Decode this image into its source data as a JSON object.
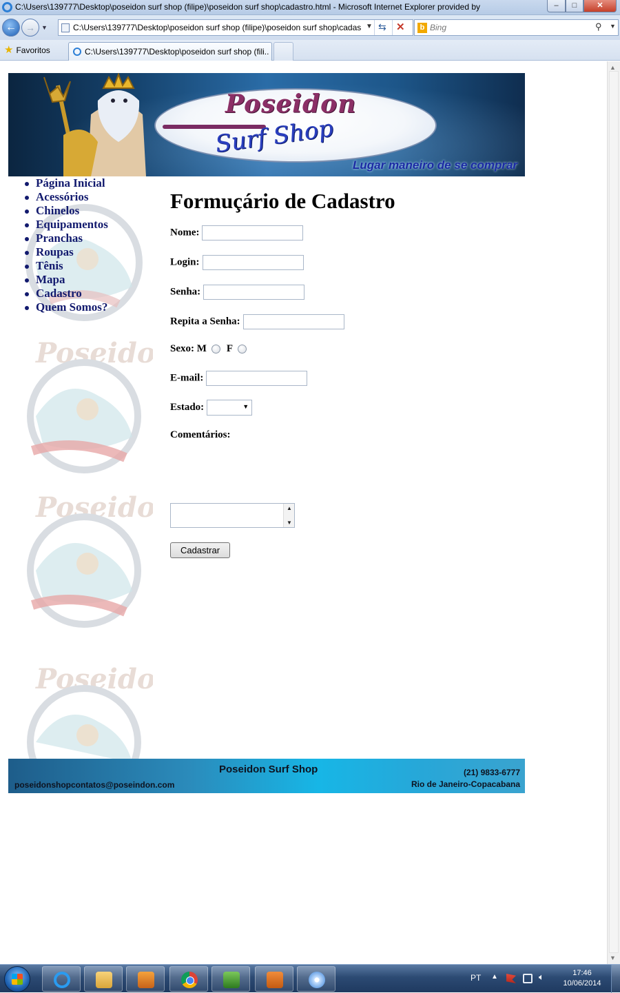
{
  "window": {
    "title": "C:\\Users\\139777\\Desktop\\poseidon surf shop (filipe)\\poseidon surf shop\\cadastro.html - Microsoft Internet Explorer provided by",
    "min_label": "–",
    "max_label": "□",
    "close_label": "✕"
  },
  "address_bar": {
    "url": "C:\\Users\\139777\\Desktop\\poseidon surf shop (filipe)\\poseidon surf shop\\cadas",
    "search_placeholder": "Bing"
  },
  "favorites": {
    "label": "Favoritos"
  },
  "tab": {
    "title": "C:\\Users\\139777\\Desktop\\poseidon surf shop (fili..."
  },
  "banner": {
    "brand_top": "Poseidon",
    "brand_bottom": "Surf Shop",
    "tagline": "Lugar maneiro de se comprar"
  },
  "sidebar": {
    "items": [
      {
        "label": "Página Inicial"
      },
      {
        "label": "Acessórios"
      },
      {
        "label": "Chinelos"
      },
      {
        "label": "Equipamentos"
      },
      {
        "label": "Pranchas"
      },
      {
        "label": "Roupas"
      },
      {
        "label": "Tênis"
      },
      {
        "label": "Mapa"
      },
      {
        "label": "Cadastro"
      },
      {
        "label": "Quem Somos?"
      }
    ]
  },
  "form": {
    "title": "Formuçário de Cadastro",
    "nome_label": "Nome:",
    "login_label": "Login:",
    "senha_label": "Senha:",
    "repita_label": "Repita a Senha:",
    "sexo_label": "Sexo:",
    "sexo_m": "M",
    "sexo_f": "F",
    "email_label": "E-mail:",
    "estado_label": "Estado:",
    "comentarios_label": "Comentários:",
    "submit_label": "Cadastrar"
  },
  "footer": {
    "name": "Poseidon Surf Shop",
    "email": "poseidonshopcontatos@poseindon.com",
    "phone": "(21) 9833-6777",
    "city": "Rio de Janeiro-Copacabana"
  },
  "taskbar": {
    "language": "PT",
    "time": "17:46",
    "date": "10/06/2014"
  }
}
